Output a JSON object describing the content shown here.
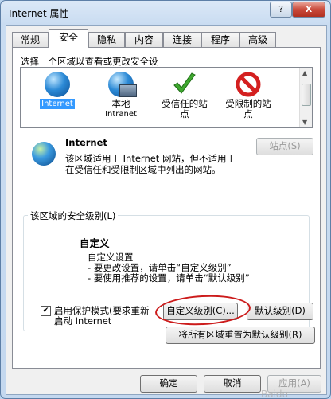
{
  "window": {
    "title": "Internet 属性",
    "help_label": "?",
    "close_label": "X"
  },
  "tabs": [
    "常规",
    "安全",
    "隐私",
    "内容",
    "连接",
    "程序",
    "高级"
  ],
  "security": {
    "zone_prompt": "选择一个区域以查看或更改安全设",
    "zones": [
      {
        "name": "Internet",
        "sub": "",
        "icon": "globe-icon"
      },
      {
        "name": "本地",
        "sub": "Intranet",
        "icon": "intranet-globe-icon"
      },
      {
        "name": "受信任的站",
        "sub": "点",
        "icon": "checkmark-icon"
      },
      {
        "name": "受限制的站",
        "sub": "点",
        "icon": "restricted-icon"
      }
    ],
    "selected_zone": "Internet",
    "zone_title": "Internet",
    "zone_desc_1": "该区域适用于 Internet 网站，但不适用于",
    "zone_desc_2": "在受信任和受限制区域中列出的网站。",
    "sites_button": "站点(S)",
    "level_group_title": "该区域的安全级别(L)",
    "level_name": "自定义",
    "level_line_1": "自定义设置",
    "level_line_2": "- 要更改设置，请单击“自定义级别”",
    "level_line_3": "- 要使用推荐的设置，请单击“默认级别”",
    "protected_mode_1": "启用保护模式(要求重新",
    "protected_mode_2": "启动 Internet",
    "protected_mode_checked": true,
    "custom_level_button": "自定义级别(C)...",
    "default_level_button": "默认级别(D)",
    "reset_all_button": "将所有区域重置为默认级别(R)"
  },
  "footer": {
    "ok": "确定",
    "cancel": "取消",
    "apply": "应用(A)"
  },
  "watermark": "Baidu"
}
